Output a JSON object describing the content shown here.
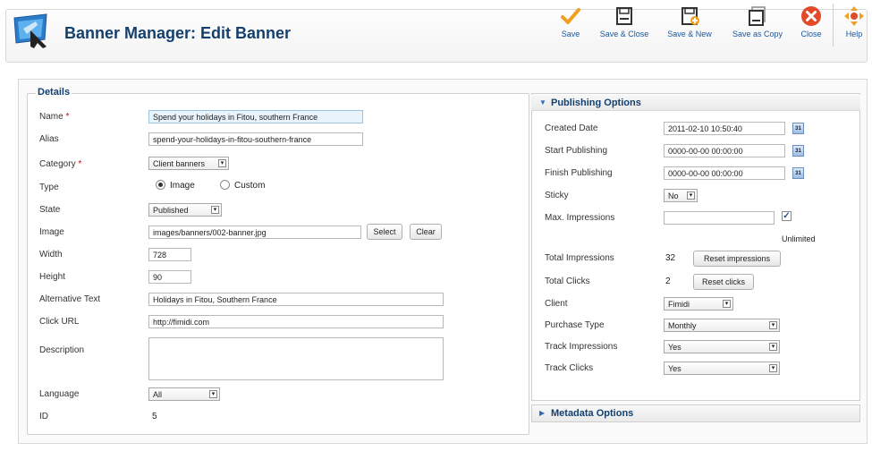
{
  "header": {
    "title": "Banner Manager: Edit Banner",
    "logo_icon": "banner-manager-icon"
  },
  "toolbar": {
    "save": "Save",
    "save_close": "Save & Close",
    "save_new": "Save & New",
    "save_copy": "Save as Copy",
    "close": "Close",
    "help": "Help"
  },
  "details": {
    "legend": "Details",
    "required_mark": "*",
    "name_label": "Name",
    "name_value": "Spend your holidays in Fitou, southern France",
    "alias_label": "Alias",
    "alias_value": "spend-your-holidays-in-fitou-southern-france",
    "category_label": "Category",
    "category_value": "Client banners",
    "type_label": "Type",
    "type_image": "Image",
    "type_custom": "Custom",
    "state_label": "State",
    "state_value": "Published",
    "image_label": "Image",
    "image_value": "images/banners/002-banner.jpg",
    "select_button": "Select",
    "clear_button": "Clear",
    "width_label": "Width",
    "width_value": "728",
    "height_label": "Height",
    "height_value": "90",
    "alt_label": "Alternative Text",
    "alt_value": "Holidays in Fitou, Southern France",
    "click_url_label": "Click URL",
    "click_url_value": "http://fimidi.com",
    "description_label": "Description",
    "description_value": "",
    "language_label": "Language",
    "language_value": "All",
    "id_label": "ID",
    "id_value": "5"
  },
  "publishing": {
    "title": "Publishing Options",
    "created_label": "Created Date",
    "created_value": "2011-02-10 10:50:40",
    "start_label": "Start Publishing",
    "start_value": "0000-00-00 00:00:00",
    "finish_label": "Finish Publishing",
    "finish_value": "0000-00-00 00:00:00",
    "sticky_label": "Sticky",
    "sticky_value": "No",
    "max_imp_label": "Max. Impressions",
    "max_imp_value": "",
    "unlimited_label": "Unlimited",
    "total_imp_label": "Total Impressions",
    "total_imp_value": "32",
    "reset_imp_button": "Reset impressions",
    "total_clicks_label": "Total Clicks",
    "total_clicks_value": "2",
    "reset_clicks_button": "Reset clicks",
    "client_label": "Client",
    "client_value": "Fimidi",
    "purchase_label": "Purchase Type",
    "purchase_value": "Monthly",
    "track_imp_label": "Track Impressions",
    "track_imp_value": "Yes",
    "track_clicks_label": "Track Clicks",
    "track_clicks_value": "Yes",
    "calendar_text": "31"
  },
  "metadata": {
    "title": "Metadata Options"
  },
  "colors": {
    "title_blue": "#14406f",
    "toolbar_label": "#1b57a0",
    "save_check": "#f0a020",
    "close_red": "#e24a2a"
  }
}
